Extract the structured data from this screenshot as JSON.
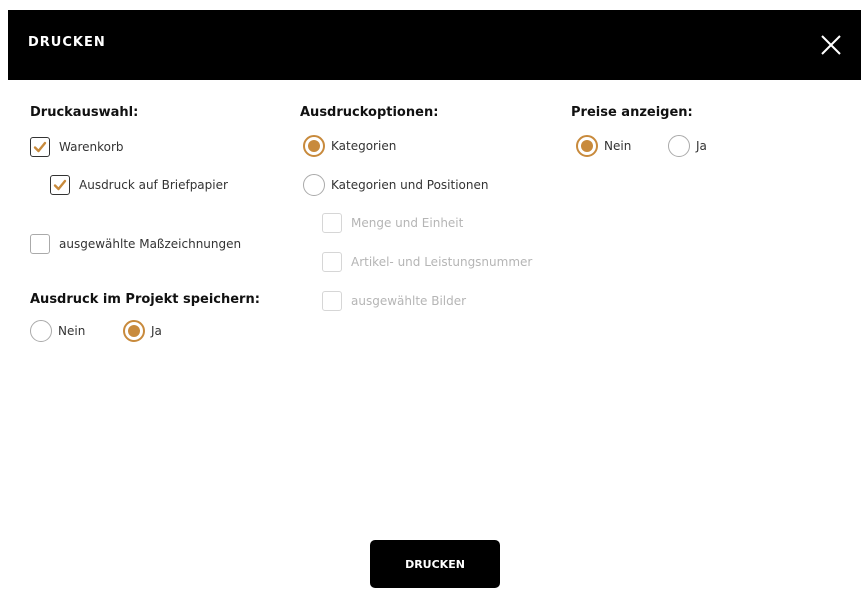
{
  "dialog": {
    "title": "DRUCKEN",
    "close_icon": "close-icon"
  },
  "col1": {
    "title": "Druckauswahl:",
    "warenkorb": "Warenkorb",
    "briefpapier": "Ausdruck auf Briefpapier",
    "masszeichnungen": "ausgewählte Maßzeichnungen",
    "projekt_title": "Ausdruck im Projekt speichern:",
    "projekt_nein": "Nein",
    "projekt_ja": "Ja",
    "checked": {
      "warenkorb": true,
      "briefpapier": true,
      "masszeichnungen": false
    },
    "projekt_selected": "Ja"
  },
  "col2": {
    "title": "Ausdruckoptionen:",
    "kategorien": "Kategorien",
    "kategorien_positionen": "Kategorien und Positionen",
    "menge": "Menge und Einheit",
    "artikel": "Artikel- und Leistungsnummer",
    "bilder": "ausgewählte Bilder",
    "selected": "Kategorien"
  },
  "col3": {
    "title": "Preise anzeigen:",
    "nein": "Nein",
    "ja": "Ja",
    "selected": "Nein"
  },
  "footer": {
    "print_label": "DRUCKEN"
  },
  "colors": {
    "accent": "#c88a3c",
    "header_bg": "#000000"
  }
}
